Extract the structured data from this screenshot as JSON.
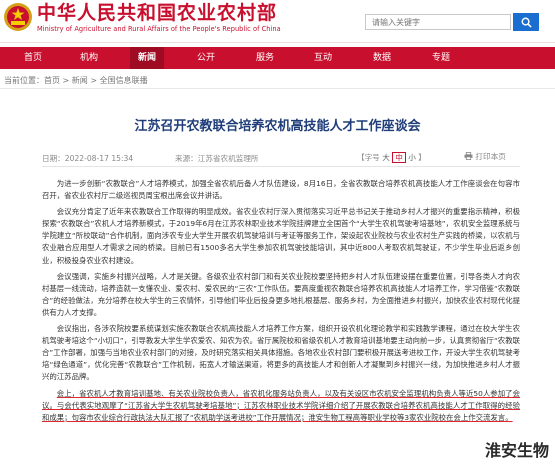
{
  "header": {
    "site_title": "中华人民共和国农业农村部",
    "site_subtitle": "Ministry of Agriculture and Rural Affairs of the People's Republic of China",
    "search_placeholder": "请输入关键字",
    "emblem_icon": "national-emblem-icon",
    "search_icon": "search-icon"
  },
  "nav": {
    "items": [
      "首页",
      "机构",
      "新闻",
      "公开",
      "服务",
      "互动",
      "数据",
      "专题"
    ],
    "active_index": 2
  },
  "breadcrumb": "当前位置：首页 > 新闻 > 全国信息联播",
  "article": {
    "title": "江苏召开农教联合培养农机高技能人才工作座谈会",
    "date": "日期：2022-08-17 15:34",
    "source": "来源：江苏省农机监理所",
    "size_label": "【字号",
    "size_big": "大",
    "size_mid": "中",
    "size_small": "小",
    "size_end": "】",
    "print_label": "打印本页",
    "print_icon": "printer-icon",
    "paragraphs": [
      "为进一步创新“农教联合”人才培养模式，加强全省农机后备人才队伍建设，8月16日，全省农教联合培养农机高技能人才工作座谈会在句容市召开，省农业农村厅二级巡视员周宝根出席会议并讲话。",
      "会议充分肯定了近年来农教联合工作取得的明显成效。省农业农村厅深入贯彻落实习近平总书记关于推动乡村人才振兴的重要指示精神，积极探索“农教联合”农机人才培养新模式，于2019年6月在江苏农林职业技术学院挂牌建立全国首个“大学生农机驾驶考培基地”，农机安全监理系统与学院建立“所校联动”合作机制，面向涉农专业大学生开展农机驾驶培训与考证等服务工作，架设起农业院校与农业农村生产实践的桥梁，以农机与农业融合应用型人才需求之间的桥梁。目前已有1500多名大学生参加农机驾驶技能培训，其中近800人考取农机驾驶证，不少学生毕业后返乡创业，积极投身农业农村建设。",
      "会议强调，实施乡村振兴战略，人才是关键。各级农业农村部门和有关农业院校要坚持把乡村人才队伍建设摆在重要位置，引导各类人才向农村基层一线流动，培养造就一支懂农业、爱农村、爱农民的“三农”工作队伍。要高度重视农教联合培养农机高技能人才培养工作，学习借鉴“农教联合”的经验做法，充分培养在校大学生的三农情怀，引导他们毕业后投身更多地扎根基层、服务乡村，为全面推进乡村振兴，加快农业农村现代化提供有力人才支撑。",
      "会议指出，各涉农院校要系统谋划实施农教联合农机高技能人才培养工作方案，组织开设农机化理论教学和实践教学课程，通过在校大学生农机驾驶考培这个“小切口”，引导教发大学生学农爱农、知农为农。省厅属院校和省级农机人才教育培训基地要主动向前一步，认真贯彻省厅“农教联合”工作部署，加强与当地农业农村部门的对接，及时研究落实相关具体措施。各地农业农村部门要积极开展送考进校工作，开设大学生农机驾驶考培“绿色通道”，优化完善“农教联合”工作机制，拓宽人才输送渠道，将更多的高技能人才和创新人才凝聚到乡村振兴一线，为加快推进乡村人才振兴的江苏品牌。",
      "会上，省农机人才教育培训基地、有关农业院校负责人，省农机化服务站负责人，以及有关设区市农机安全监理机构负责人等近50人参加了会议。与会代表实地观摩了“江苏省大学生农机驾驶考培基地”；江苏农林职业技术学院详细介绍了开展农教联合培养农机高技能人才工作取得的经验和成果；句容市农业综合行政执法大队汇报了“农机助学送考进校”工作开展情况；淮安生物工程高等职业学校等3家农业院校在会上作交流发言。"
    ]
  },
  "watermark": "淮安生物"
}
